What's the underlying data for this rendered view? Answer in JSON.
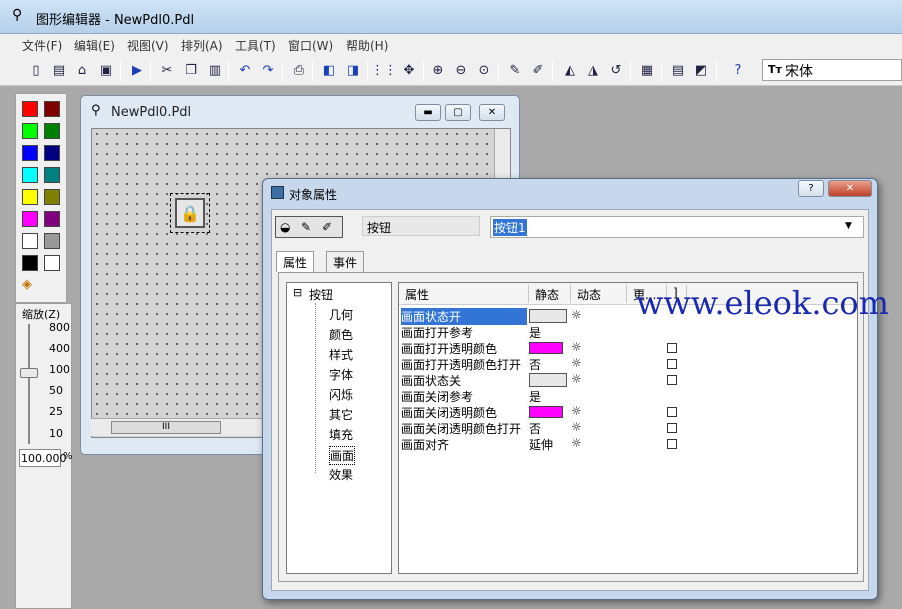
{
  "app": {
    "title": "图形编辑器 - NewPdl0.Pdl"
  },
  "menu": [
    "文件(F)",
    "编辑(E)",
    "视图(V)",
    "排列(A)",
    "工具(T)",
    "窗口(W)",
    "帮助(H)"
  ],
  "toolbar": {
    "icons": [
      "new-icon",
      "new-template-icon",
      "open-icon",
      "save-icon",
      "run-icon",
      "cut-icon",
      "copy-icon",
      "paste-icon",
      "undo-icon",
      "redo-icon",
      "print-icon",
      "bring-front-icon",
      "send-back-icon",
      "grid-icon",
      "snap-icon",
      "zoom-in-icon",
      "zoom-out-icon",
      "zoom-fit-icon",
      "pick-icon",
      "pick2-icon",
      "flip-h-icon",
      "flip-v-icon",
      "rotate-icon",
      "align-icon",
      "list-icon",
      "palette-icon",
      "help-icon"
    ],
    "font_prefix": "Tт",
    "font_name": "宋体"
  },
  "palette": {
    "colors": [
      "#ff0000",
      "#800000",
      "#00ff00",
      "#008000",
      "#0000ff",
      "#000080",
      "#00ffff",
      "#008080",
      "#ffff00",
      "#808000",
      "#ff00ff",
      "#800080",
      "#ffffff",
      "#999999",
      "#000000",
      "#ffffff"
    ],
    "zoom_label": "缩放(Z)",
    "zoom_ticks": [
      "800",
      "400",
      "100",
      "50",
      "25",
      "10"
    ],
    "zoom_value": "100.000",
    "zoom_unit": "%"
  },
  "doc_window": {
    "title": "NewPdl0.Pdl",
    "hscroll_grip": "III"
  },
  "dialog": {
    "title": "对象属性",
    "help_btn": "?",
    "close_btn": "✕",
    "object_type": "按钮",
    "object_name": "按钮1",
    "tabs": [
      "属性",
      "事件"
    ],
    "tree": {
      "root": "按钮",
      "expander": "⊟",
      "children": [
        "几何",
        "颜色",
        "样式",
        "字体",
        "闪烁",
        "其它",
        "填充",
        "画面",
        "效果"
      ]
    },
    "grid": {
      "columns": [
        "属性",
        "静态",
        "动态",
        "更...",
        "]"
      ],
      "rows": [
        {
          "name": "画面状态开",
          "value": "",
          "type": "button-image",
          "bulb": true,
          "check": false
        },
        {
          "name": "画面打开参考",
          "value": "是",
          "type": "text",
          "bulb": false,
          "check": false
        },
        {
          "name": "画面打开透明颜色",
          "value": "",
          "type": "color",
          "bulb": true,
          "check": true
        },
        {
          "name": "画面打开透明颜色打开",
          "value": "否",
          "type": "text",
          "bulb": true,
          "check": true
        },
        {
          "name": "画面状态关",
          "value": "",
          "type": "button-image",
          "bulb": true,
          "check": true
        },
        {
          "name": "画面关闭参考",
          "value": "是",
          "type": "text",
          "bulb": false,
          "check": false
        },
        {
          "name": "画面关闭透明颜色",
          "value": "",
          "type": "color",
          "bulb": true,
          "check": true
        },
        {
          "name": "画面关闭透明颜色打开",
          "value": "否",
          "type": "text",
          "bulb": true,
          "check": true
        },
        {
          "name": "画面对齐",
          "value": "延伸",
          "type": "text",
          "bulb": true,
          "check": true
        }
      ]
    }
  },
  "watermark": "www.eleok.com"
}
